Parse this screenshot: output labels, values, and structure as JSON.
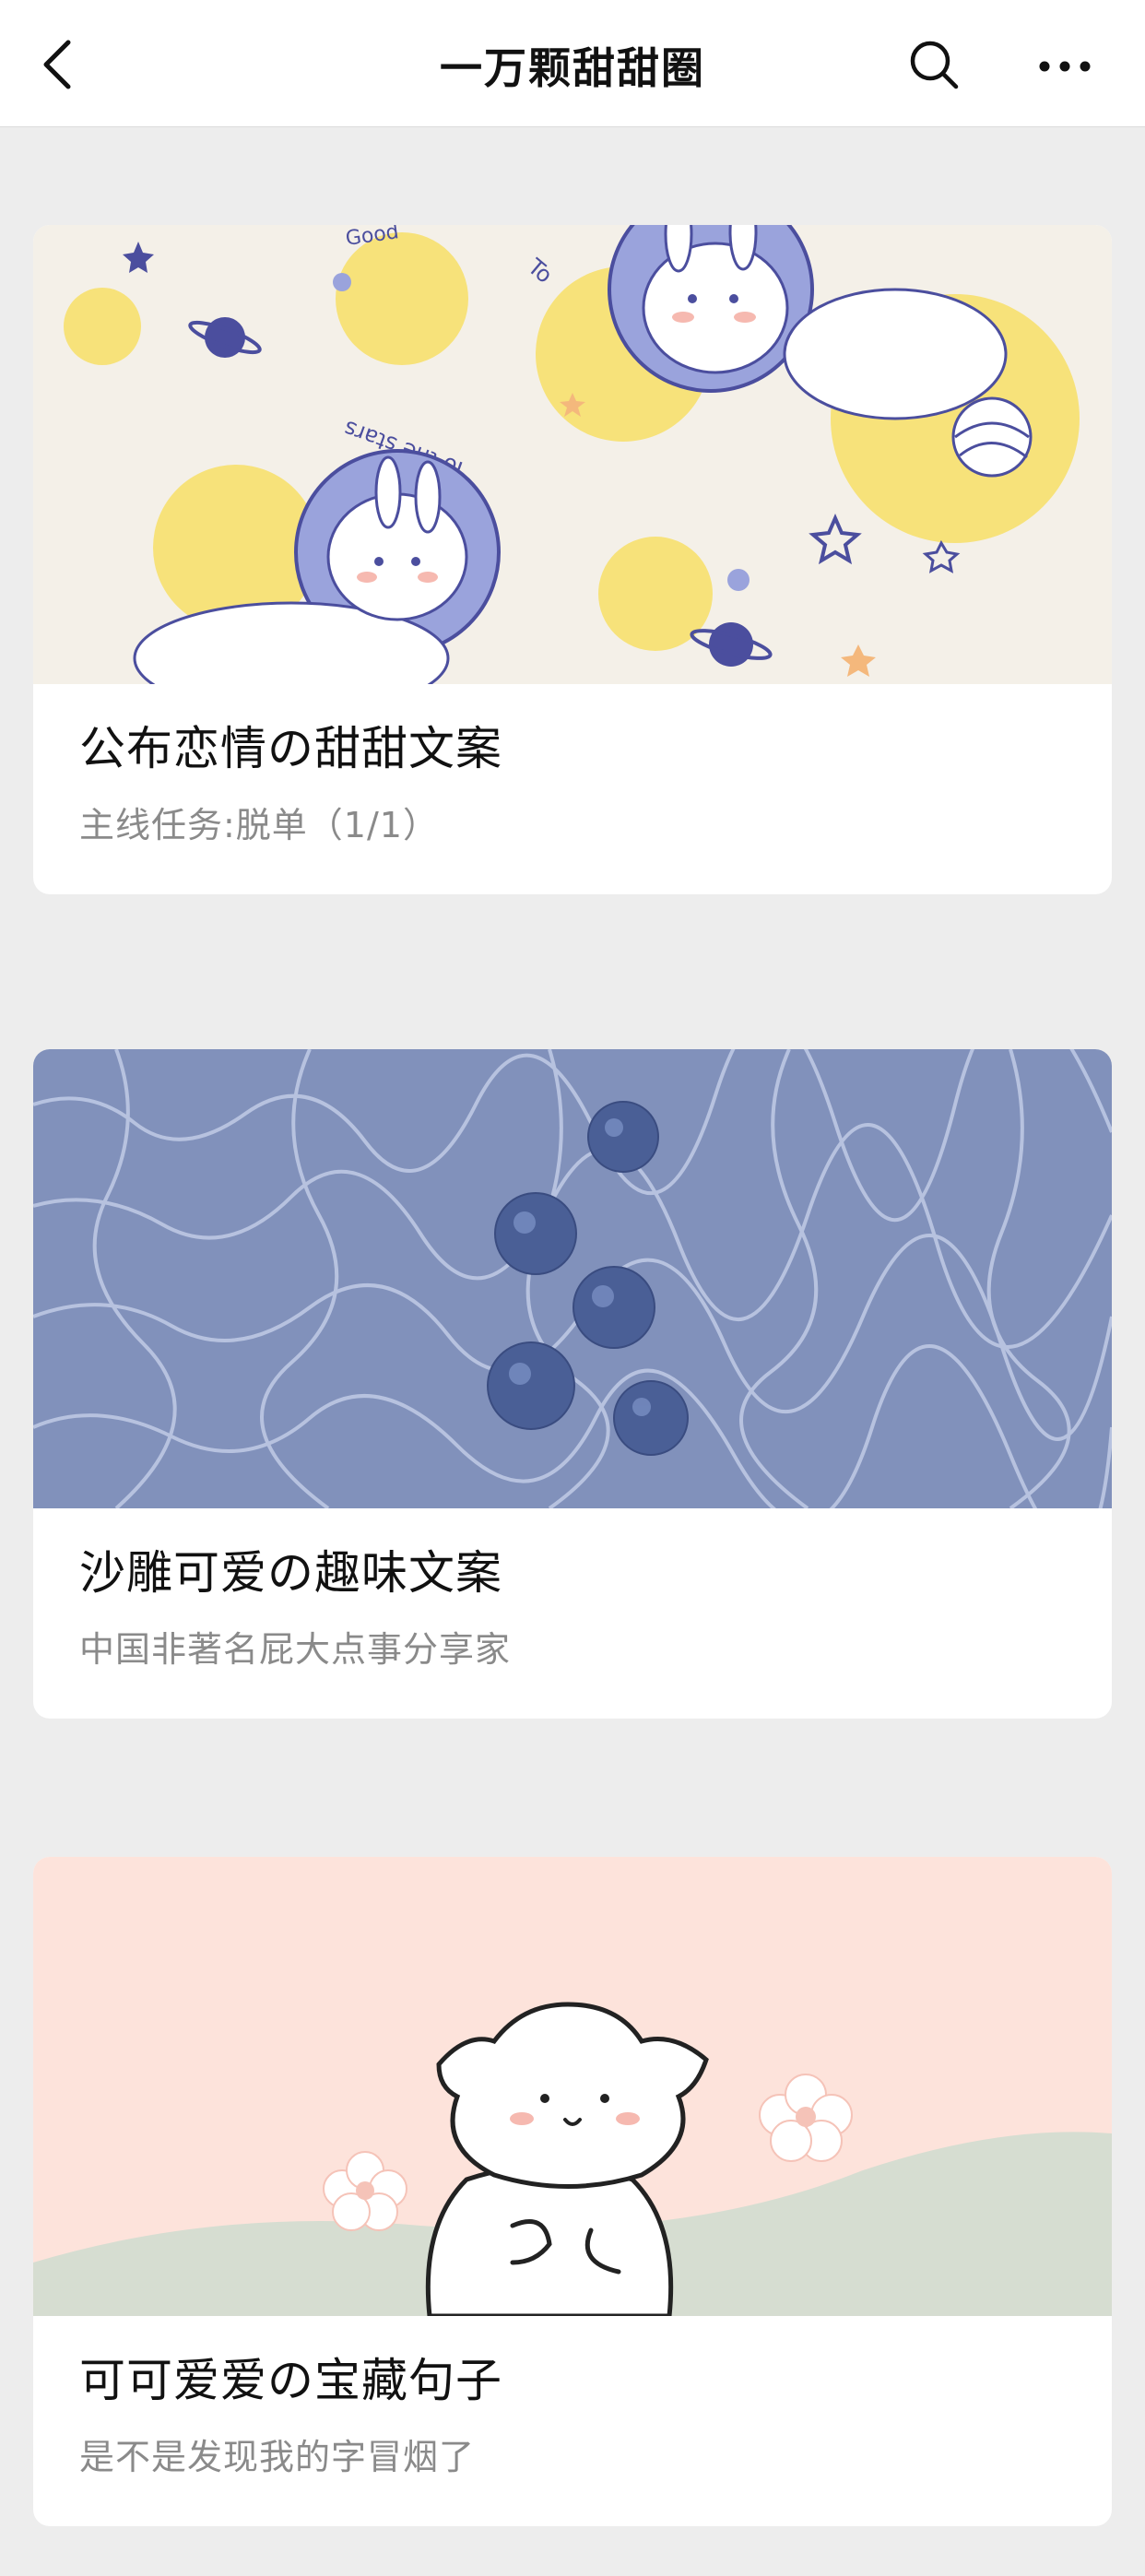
{
  "header": {
    "title": "一万颗甜甜圈",
    "back_icon": "chevron-left-icon",
    "search_icon": "search-icon",
    "more_icon": "more-horizontal-icon"
  },
  "articles": [
    {
      "title": "公布恋情の甜甜文案",
      "subtitle": "主线任务:脱单（1/1）",
      "cover": {
        "description_tag": "bunny-astronaut-illustration",
        "texts": [
          "Good",
          "To",
          "To the stars"
        ],
        "colors": {
          "background": "#f4f0e8",
          "circle": "#f7e27a",
          "accent": "#4b4e9e",
          "bubble": "#9aa3dc"
        }
      }
    },
    {
      "title": "沙雕可爱の趣味文案",
      "subtitle": "中国非著名屁大点事分享家",
      "cover": {
        "description_tag": "blueberries-in-water-photo",
        "colors": {
          "background": "#8191bb",
          "berry": "#4a5f96",
          "ripple": "#c9d3ec"
        }
      }
    },
    {
      "title": "可可爱爱の宝藏句子",
      "subtitle": "是不是发现我的字冒烟了",
      "cover": {
        "description_tag": "white-cat-doodle-illustration",
        "colors": {
          "background": "#fde3db",
          "hill": "#d6ddd1",
          "outline": "#222222"
        }
      }
    }
  ]
}
